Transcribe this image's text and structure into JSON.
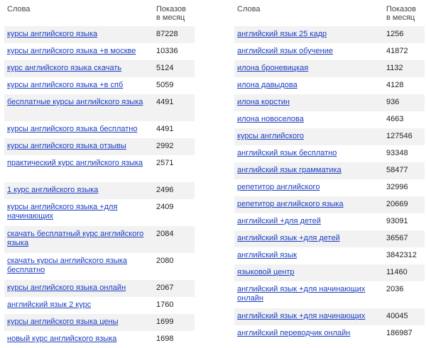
{
  "header": {
    "words": "Слова",
    "count_line1": "Показов",
    "count_line2": "в месяц"
  },
  "left": [
    {
      "kw": "курсы английского языка",
      "count": "87228"
    },
    {
      "kw": "курсы английского языка +в москве",
      "count": "10336"
    },
    {
      "kw": "курс английского языка скачать",
      "count": "5124"
    },
    {
      "kw": "курсы английского языка +в спб",
      "count": "5059"
    },
    {
      "kw": "бесплатные курсы английского языка",
      "count": "4491"
    },
    {
      "kw": "курсы английского языка бесплатно",
      "count": "4491"
    },
    {
      "kw": "курсы английского языка отзывы",
      "count": "2992"
    },
    {
      "kw": "практический курс английского языка",
      "count": "2571"
    },
    {
      "kw": "1 курс английского языка",
      "count": "2496"
    },
    {
      "kw": "курсы английского языка +для начинающих",
      "count": "2409"
    },
    {
      "kw": "скачать бесплатный курс английского языка",
      "count": "2084"
    },
    {
      "kw": "скачать курсы английского языка бесплатно",
      "count": "2080"
    },
    {
      "kw": "курсы английского языка онлайн",
      "count": "2067"
    },
    {
      "kw": "английский язык 2 курс",
      "count": "1760"
    },
    {
      "kw": "курсы английского языка цены",
      "count": "1699"
    },
    {
      "kw": "новый курс английского языка",
      "count": "1698"
    }
  ],
  "right": [
    {
      "kw": "английский язык 25 кадр",
      "count": "1256"
    },
    {
      "kw": "английский язык обучение",
      "count": "41872"
    },
    {
      "kw": "илона броневицкая",
      "count": "1132"
    },
    {
      "kw": "илона давыдова",
      "count": "4128"
    },
    {
      "kw": "илона корстин",
      "count": "936"
    },
    {
      "kw": "илона новоселова",
      "count": "4663"
    },
    {
      "kw": "курсы английского",
      "count": "127546"
    },
    {
      "kw": "английский язык бесплатно",
      "count": "93348"
    },
    {
      "kw": "английский язык грамматика",
      "count": "58477"
    },
    {
      "kw": "репетитор английского",
      "count": "32996"
    },
    {
      "kw": "репетитор английского языка",
      "count": "20669"
    },
    {
      "kw": "английский +для детей",
      "count": "93091"
    },
    {
      "kw": "английский язык +для детей",
      "count": "36567"
    },
    {
      "kw": "английский язык",
      "count": "3842312"
    },
    {
      "kw": "языковой центр",
      "count": "11460"
    },
    {
      "kw": "английский язык +для начинающих онлайн",
      "count": "2036"
    },
    {
      "kw": "английский язык +для начинающих",
      "count": "40045"
    },
    {
      "kw": "английский переводчик онлайн",
      "count": "186987"
    }
  ]
}
